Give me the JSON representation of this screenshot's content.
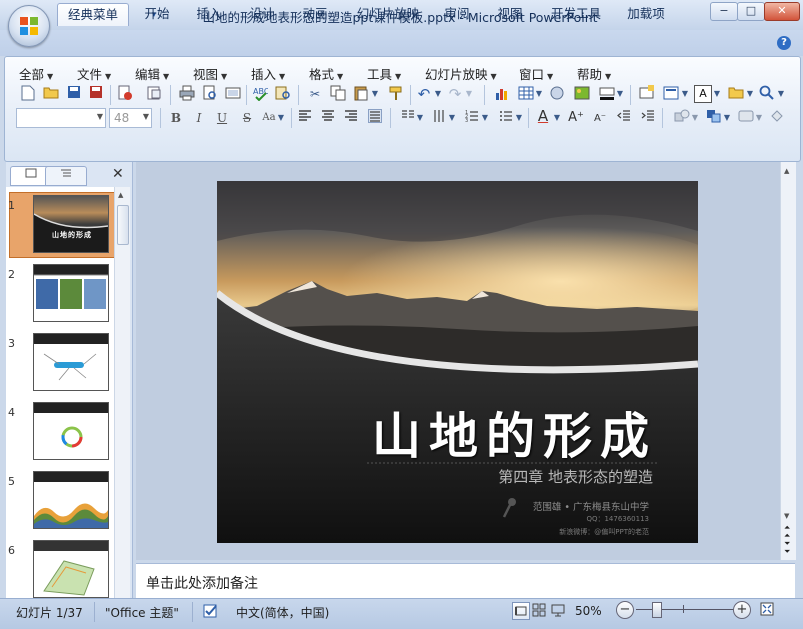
{
  "window": {
    "title": "山地的形成地表形态的塑造ppt课件模板.pptx - Microsoft PowerPoint",
    "minimize_label": "−",
    "maximize_label": "□",
    "close_label": "✕"
  },
  "quick_access": {
    "save_icon": "save-icon",
    "undo_icon": "undo-icon",
    "redo_icon": "redo-icon",
    "customize": "▾"
  },
  "tabs": [
    {
      "label": "经典菜单",
      "active": true
    },
    {
      "label": "开始"
    },
    {
      "label": "插入"
    },
    {
      "label": "设计"
    },
    {
      "label": "动画"
    },
    {
      "label": "幻灯片放映"
    },
    {
      "label": "审阅"
    },
    {
      "label": "视图"
    },
    {
      "label": "开发工具"
    },
    {
      "label": "加载项"
    }
  ],
  "menu": [
    "全部",
    "文件",
    "编辑",
    "视图",
    "插入",
    "格式",
    "工具",
    "幻灯片放映",
    "窗口",
    "帮助"
  ],
  "format": {
    "font_name": "",
    "font_size": "48"
  },
  "panel": {
    "close": "✕"
  },
  "thumbnails": [
    {
      "num": "1",
      "title": "山地的形成"
    },
    {
      "num": "2",
      "title": ""
    },
    {
      "num": "3",
      "title": ""
    },
    {
      "num": "4",
      "title": ""
    },
    {
      "num": "5",
      "title": ""
    },
    {
      "num": "6",
      "title": ""
    }
  ],
  "slide": {
    "title": "山地的形成",
    "subtitle": "第四章  地表形态的塑造",
    "author": "范围雄 • 广东梅县东山中学",
    "qq": "QQ：1476360113",
    "credit": "新浪微博：@偏叫PPT的老范"
  },
  "notes": {
    "placeholder": "单击此处添加备注"
  },
  "status": {
    "slide_info": "幻灯片 1/37",
    "theme": "\"Office 主题\"",
    "language": "中文(简体，中国)",
    "zoom": "50%"
  },
  "colors": {
    "accent": "#2f6dc4",
    "ribbon_bg": "#dbe6f4",
    "selected_thumb": "#e8a46a"
  }
}
